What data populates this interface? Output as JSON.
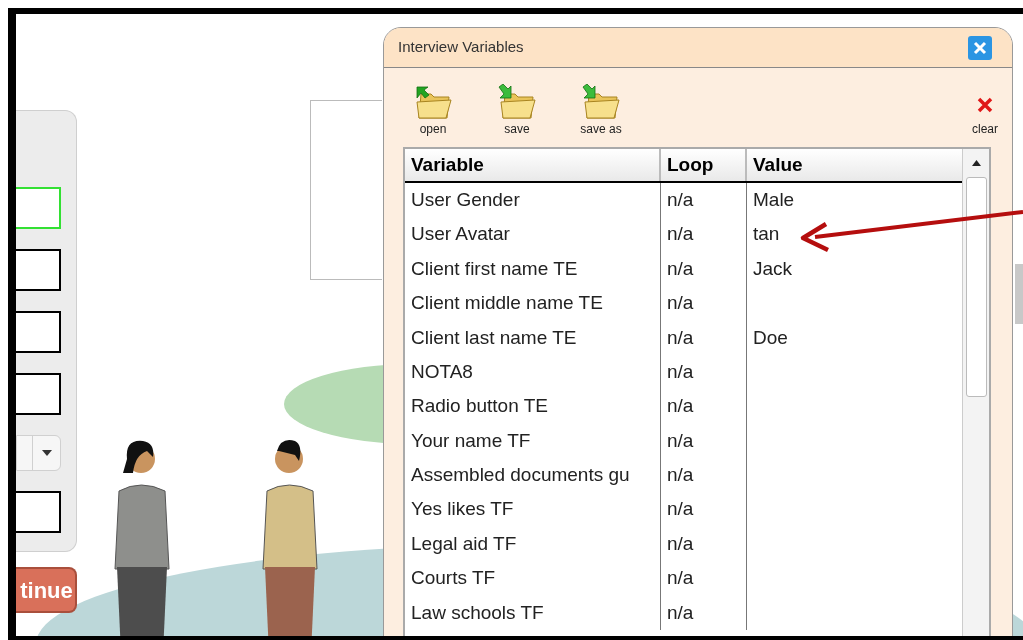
{
  "background_form": {
    "fields": [
      {
        "kind": "text",
        "focused": true
      },
      {
        "kind": "text",
        "focused": false
      },
      {
        "kind": "text",
        "focused": false
      },
      {
        "kind": "text",
        "focused": false
      },
      {
        "kind": "select",
        "focused": false
      },
      {
        "kind": "text",
        "focused": false
      }
    ],
    "continue_button": "tinue"
  },
  "dialog": {
    "title": "Interview Variables",
    "toolbar": [
      {
        "kind": "open",
        "label": "open"
      },
      {
        "kind": "save",
        "label": "save"
      },
      {
        "kind": "save",
        "label": "save as"
      }
    ],
    "clear": "clear",
    "table": {
      "columns": [
        "Variable",
        "Loop",
        "Value"
      ],
      "rows": [
        [
          "User Gender",
          "n/a",
          "Male"
        ],
        [
          "User Avatar",
          "n/a",
          "tan"
        ],
        [
          "Client first name TE",
          "n/a",
          "Jack"
        ],
        [
          "Client middle name TE",
          "n/a",
          ""
        ],
        [
          "Client last name TE",
          "n/a",
          "Doe"
        ],
        [
          "NOTA8",
          "n/a",
          ""
        ],
        [
          "Radio button TE",
          "n/a",
          ""
        ],
        [
          "Your name TF",
          "n/a",
          ""
        ],
        [
          "Assembled documents gu",
          "n/a",
          ""
        ],
        [
          "Yes likes TF",
          "n/a",
          ""
        ],
        [
          "Legal aid TF",
          "n/a",
          ""
        ],
        [
          "Courts TF",
          "n/a",
          ""
        ],
        [
          "Law schools TF",
          "n/a",
          ""
        ]
      ]
    }
  }
}
